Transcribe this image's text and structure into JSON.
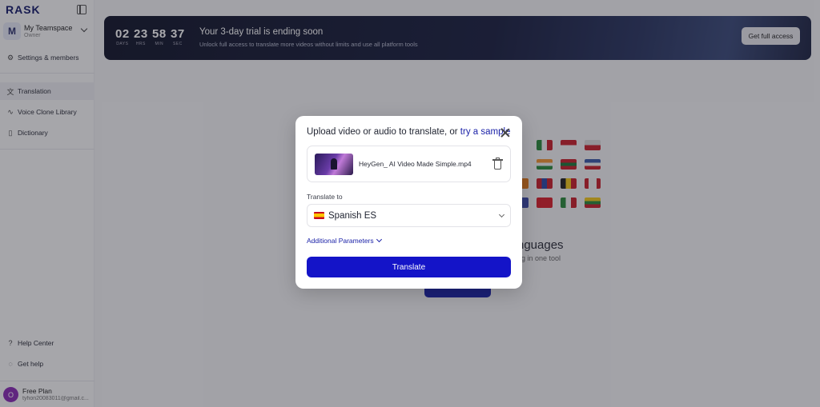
{
  "app": {
    "logo_text": "RASK"
  },
  "sidebar": {
    "team": {
      "initial": "M",
      "name": "My Teamspace",
      "role": "Owner"
    },
    "settings_label": "Settings & members",
    "items": [
      {
        "label": "Translation",
        "icon": "translate-icon"
      },
      {
        "label": "Voice Clone Library",
        "icon": "waveform-icon"
      },
      {
        "label": "Dictionary",
        "icon": "book-icon"
      }
    ],
    "bottom": [
      {
        "label": "Help Center",
        "icon": "help-icon"
      },
      {
        "label": "Get help",
        "icon": "chat-icon"
      }
    ],
    "user": {
      "initial": "O",
      "plan": "Free Plan",
      "email": "tyhon20083011@gmail.c..."
    }
  },
  "banner": {
    "countdown": [
      {
        "value": "02",
        "unit": "DAYS"
      },
      {
        "value": "23",
        "unit": "HRS"
      },
      {
        "value": "58",
        "unit": "MIN"
      },
      {
        "value": "37",
        "unit": "SEC"
      }
    ],
    "title": "Your 3-day trial is ending soon",
    "subtitle": "Unlock full access to translate more videos without limits and use all platform tools",
    "cta": "Get full access"
  },
  "background": {
    "title": "nguages",
    "subtitle": "ng in one tool"
  },
  "modal": {
    "title_prefix": "Upload video or audio to translate, or ",
    "title_link": "try a sample",
    "file_name": "HeyGen_ AI Video Made Simple.mp4",
    "translate_to_label": "Translate to",
    "selected_language": "Spanish ES",
    "additional_params": "Additional Parameters",
    "translate_button": "Translate"
  },
  "colors": {
    "accent": "#1414c8",
    "link": "#1b22a8",
    "banner_bg": "#12162a"
  }
}
